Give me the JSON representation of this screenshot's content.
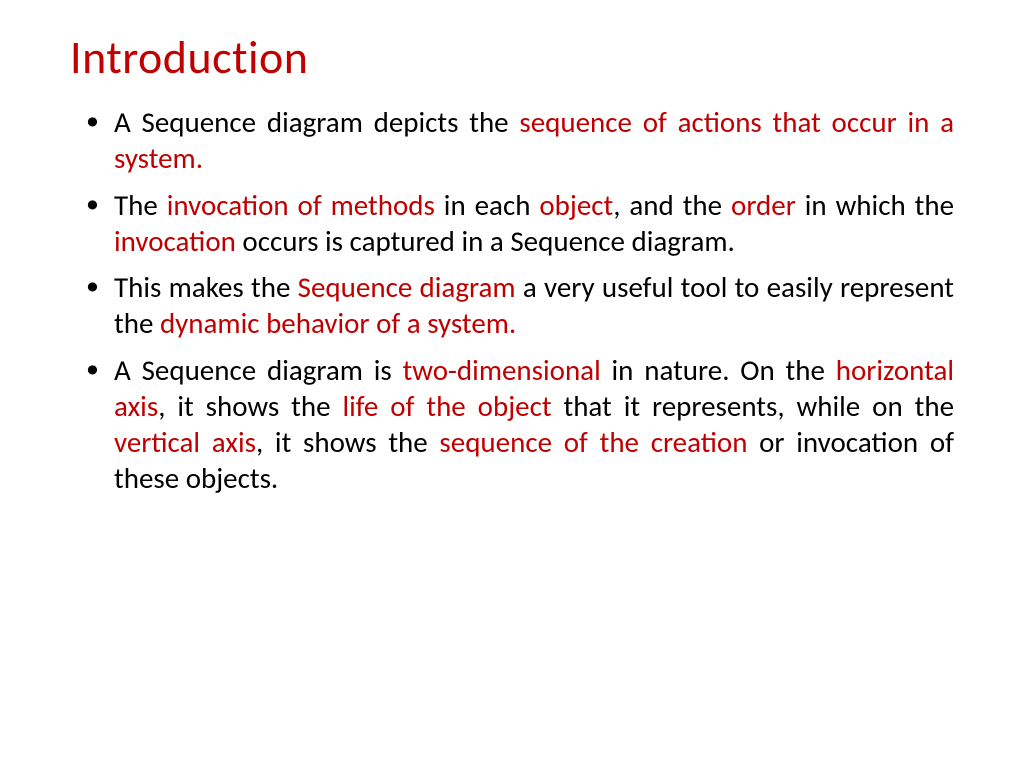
{
  "title": "Introduction",
  "bullets": [
    {
      "parts": [
        {
          "text": "A Sequence diagram depicts the ",
          "hl": false
        },
        {
          "text": "sequence of actions that occur in a system.",
          "hl": true
        }
      ]
    },
    {
      "parts": [
        {
          "text": "The ",
          "hl": false
        },
        {
          "text": "invocation of methods ",
          "hl": true
        },
        {
          "text": "in each ",
          "hl": false
        },
        {
          "text": "object",
          "hl": true
        },
        {
          "text": ", and the ",
          "hl": false
        },
        {
          "text": "order ",
          "hl": true
        },
        {
          "text": "in which the ",
          "hl": false
        },
        {
          "text": "invocation ",
          "hl": true
        },
        {
          "text": "occurs is captured in a Sequence diagram.",
          "hl": false
        }
      ]
    },
    {
      "parts": [
        {
          "text": "This makes the ",
          "hl": false
        },
        {
          "text": "Sequence diagram ",
          "hl": true
        },
        {
          "text": "a very useful tool to easily represent the ",
          "hl": false
        },
        {
          "text": "dynamic behavior of a system.",
          "hl": true
        }
      ]
    },
    {
      "parts": [
        {
          "text": "A Sequence diagram is ",
          "hl": false
        },
        {
          "text": "two-dimensional ",
          "hl": true
        },
        {
          "text": "in nature. On the ",
          "hl": false
        },
        {
          "text": "horizontal axis",
          "hl": true
        },
        {
          "text": ", it shows the ",
          "hl": false
        },
        {
          "text": "life of the object ",
          "hl": true
        },
        {
          "text": "that it represents, while on the ",
          "hl": false
        },
        {
          "text": "vertical axis",
          "hl": true
        },
        {
          "text": ", it shows the ",
          "hl": false
        },
        {
          "text": "sequence of the creation ",
          "hl": true
        },
        {
          "text": "or invocation of these objects.",
          "hl": false
        }
      ]
    }
  ]
}
